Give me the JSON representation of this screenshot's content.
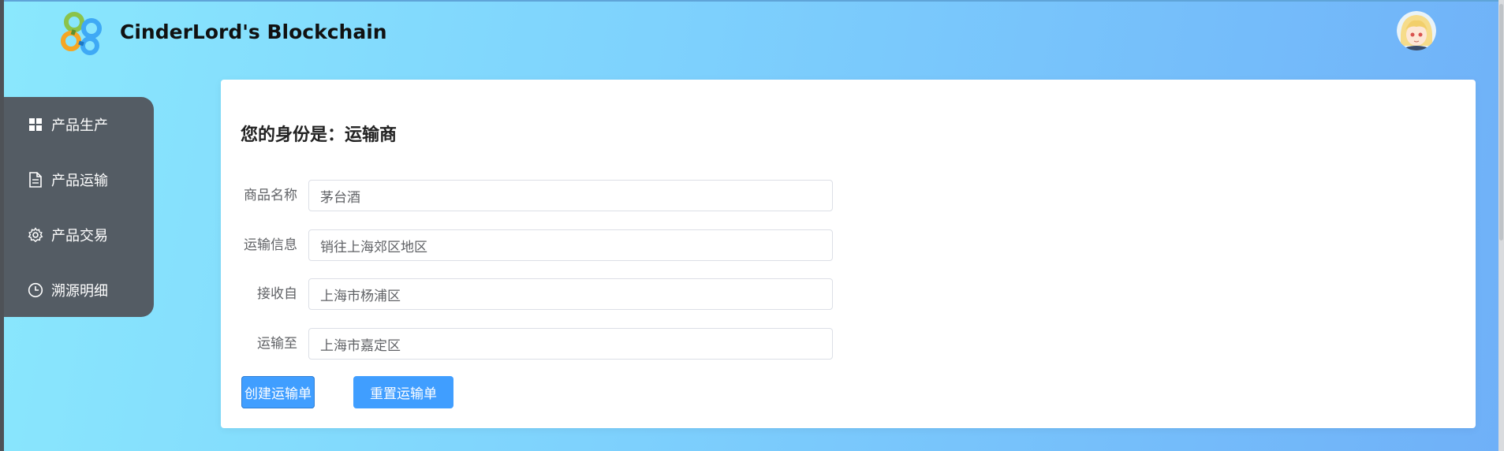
{
  "header": {
    "app_title": "CinderLord's Blockchain",
    "logo_icon": "blockchain-logo-icon",
    "avatar_icon": "anime-avatar-icon"
  },
  "sidebar": {
    "items": [
      {
        "label": "产品生产",
        "icon": "grid-icon"
      },
      {
        "label": "产品运输",
        "icon": "document-icon"
      },
      {
        "label": "产品交易",
        "icon": "gear-icon"
      },
      {
        "label": "溯源明细",
        "icon": "clock-icon"
      }
    ]
  },
  "main": {
    "role_heading": "您的身份是：运输商",
    "form": {
      "product_name": {
        "label": "商品名称",
        "value": "茅台酒"
      },
      "transport_info": {
        "label": "运输信息",
        "value": "销往上海郊区地区"
      },
      "received_from": {
        "label": "接收自",
        "value": "上海市杨浦区"
      },
      "transport_to": {
        "label": "运输至",
        "value": "上海市嘉定区"
      }
    },
    "buttons": {
      "create": "创建运输单",
      "reset": "重置运输单"
    }
  },
  "colors": {
    "sidebar_bg": "#545c64",
    "primary_button": "#409eff",
    "background_start": "#8ae8fd",
    "background_end": "#6fb0f8"
  }
}
